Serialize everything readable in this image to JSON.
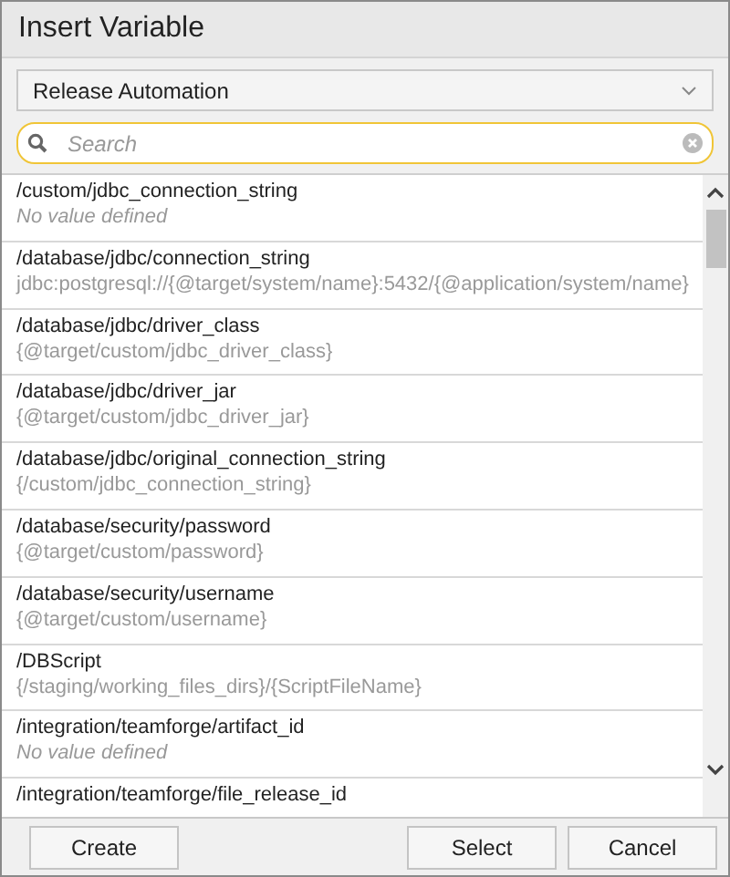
{
  "window": {
    "title": "Insert Variable"
  },
  "dropdown": {
    "value": "Release Automation"
  },
  "search": {
    "placeholder": "Search"
  },
  "variables": [
    {
      "name": "/custom/jdbc_connection_string",
      "value": "No value defined",
      "defined": false
    },
    {
      "name": "/database/jdbc/connection_string",
      "value": "jdbc:postgresql://{@target/system/name}:5432/{@application/system/name}",
      "defined": true
    },
    {
      "name": "/database/jdbc/driver_class",
      "value": "{@target/custom/jdbc_driver_class}",
      "defined": true
    },
    {
      "name": "/database/jdbc/driver_jar",
      "value": "{@target/custom/jdbc_driver_jar}",
      "defined": true
    },
    {
      "name": "/database/jdbc/original_connection_string",
      "value": "{/custom/jdbc_connection_string}",
      "defined": true
    },
    {
      "name": "/database/security/password",
      "value": "{@target/custom/password}",
      "defined": true
    },
    {
      "name": "/database/security/username",
      "value": "{@target/custom/username}",
      "defined": true
    },
    {
      "name": "/DBScript",
      "value": "{/staging/working_files_dirs}/{ScriptFileName}",
      "defined": true
    },
    {
      "name": "/integration/teamforge/artifact_id",
      "value": "No value defined",
      "defined": false
    },
    {
      "name": "/integration/teamforge/file_release_id"
    }
  ],
  "buttons": {
    "left": [
      "Create"
    ],
    "right": [
      "Select",
      "Cancel"
    ]
  }
}
